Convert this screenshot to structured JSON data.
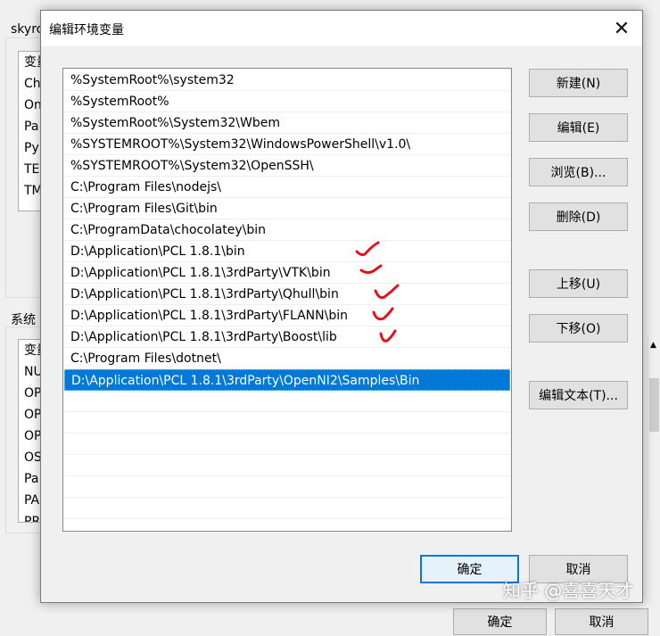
{
  "background": {
    "user_section_label": "skyrc",
    "user_vars": [
      "变量",
      "Ch",
      "On",
      "Pa",
      "Py",
      "TE",
      "TM"
    ],
    "system_section_label": "系统",
    "system_vars": [
      "变量",
      "NU",
      "OP",
      "OP",
      "OP",
      "OS",
      "Pa",
      "PA",
      "PR"
    ],
    "bottom_ok": "确定",
    "bottom_cancel": "取消"
  },
  "dialog": {
    "title": "编辑环境变量",
    "close_glyph": "✕",
    "paths": [
      "%SystemRoot%\\system32",
      "%SystemRoot%",
      "%SystemRoot%\\System32\\Wbem",
      "%SYSTEMROOT%\\System32\\WindowsPowerShell\\v1.0\\",
      "%SYSTEMROOT%\\System32\\OpenSSH\\",
      "C:\\Program Files\\nodejs\\",
      "C:\\Program Files\\Git\\bin",
      "C:\\ProgramData\\chocolatey\\bin",
      "D:\\Application\\PCL 1.8.1\\bin",
      "D:\\Application\\PCL 1.8.1\\3rdParty\\VTK\\bin",
      "D:\\Application\\PCL 1.8.1\\3rdParty\\Qhull\\bin",
      "D:\\Application\\PCL 1.8.1\\3rdParty\\FLANN\\bin",
      "D:\\Application\\PCL 1.8.1\\3rdParty\\Boost\\lib",
      "C:\\Program Files\\dotnet\\",
      "D:\\Application\\PCL 1.8.1\\3rdParty\\OpenNI2\\Samples\\Bin"
    ],
    "selected_index": 14,
    "buttons": {
      "new": "新建(N)",
      "edit": "编辑(E)",
      "browse": "浏览(B)...",
      "delete": "删除(D)",
      "move_up": "上移(U)",
      "move_down": "下移(O)",
      "edit_text": "编辑文本(T)...",
      "ok": "确定",
      "cancel": "取消"
    }
  },
  "watermark": "知乎 @喜喜天才",
  "colors": {
    "selection": "#0078d7",
    "annotation_check": "#e0141e",
    "dialog_bg": "#f0f0f0"
  }
}
